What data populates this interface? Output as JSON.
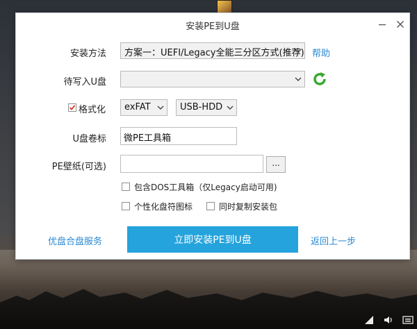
{
  "window": {
    "title": "安装PE到U盘"
  },
  "form": {
    "install_method_label": "安装方法",
    "install_method_value": "方案一：UEFI/Legacy全能三分区方式(推荐)",
    "help_link": "帮助",
    "target_disk_label": "待写入U盘",
    "target_disk_value": "",
    "format_label": "格式化",
    "format_checked": true,
    "filesystem_value": "exFAT",
    "mode_value": "USB-HDD",
    "volume_label_label": "U盘卷标",
    "volume_label_value": "微PE工具箱",
    "wallpaper_label": "PE壁纸(可选)",
    "wallpaper_value": "",
    "browse_label": "...",
    "dos_toolbox_label": "包含DOS工具箱（仅Legacy启动可用)",
    "dos_toolbox_checked": false,
    "custom_icon_label": "个性化盘符图标",
    "custom_icon_checked": false,
    "copy_installer_label": "同时复制安装包",
    "copy_installer_checked": false
  },
  "footer": {
    "left_link": "优盘合盘服务",
    "primary_button": "立即安装PE到U盘",
    "right_link": "返回上一步"
  },
  "colors": {
    "accent": "#24a3dc",
    "link": "#2a8ad4",
    "refresh_icon": "#3aa830"
  }
}
